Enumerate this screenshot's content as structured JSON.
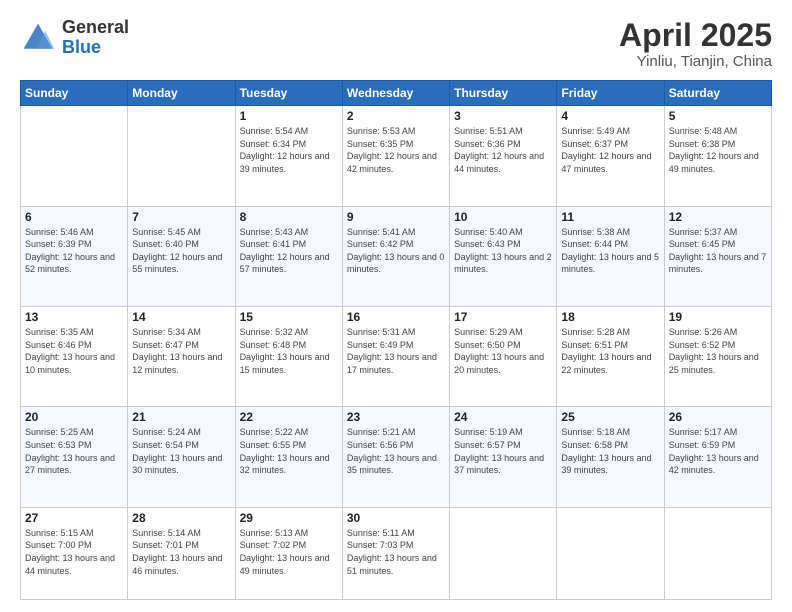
{
  "header": {
    "logo_general": "General",
    "logo_blue": "Blue",
    "title": "April 2025",
    "subtitle": "Yinliu, Tianjin, China"
  },
  "weekdays": [
    "Sunday",
    "Monday",
    "Tuesday",
    "Wednesday",
    "Thursday",
    "Friday",
    "Saturday"
  ],
  "weeks": [
    [
      {
        "day": "",
        "info": ""
      },
      {
        "day": "",
        "info": ""
      },
      {
        "day": "1",
        "info": "Sunrise: 5:54 AM\nSunset: 6:34 PM\nDaylight: 12 hours and 39 minutes."
      },
      {
        "day": "2",
        "info": "Sunrise: 5:53 AM\nSunset: 6:35 PM\nDaylight: 12 hours and 42 minutes."
      },
      {
        "day": "3",
        "info": "Sunrise: 5:51 AM\nSunset: 6:36 PM\nDaylight: 12 hours and 44 minutes."
      },
      {
        "day": "4",
        "info": "Sunrise: 5:49 AM\nSunset: 6:37 PM\nDaylight: 12 hours and 47 minutes."
      },
      {
        "day": "5",
        "info": "Sunrise: 5:48 AM\nSunset: 6:38 PM\nDaylight: 12 hours and 49 minutes."
      }
    ],
    [
      {
        "day": "6",
        "info": "Sunrise: 5:46 AM\nSunset: 6:39 PM\nDaylight: 12 hours and 52 minutes."
      },
      {
        "day": "7",
        "info": "Sunrise: 5:45 AM\nSunset: 6:40 PM\nDaylight: 12 hours and 55 minutes."
      },
      {
        "day": "8",
        "info": "Sunrise: 5:43 AM\nSunset: 6:41 PM\nDaylight: 12 hours and 57 minutes."
      },
      {
        "day": "9",
        "info": "Sunrise: 5:41 AM\nSunset: 6:42 PM\nDaylight: 13 hours and 0 minutes."
      },
      {
        "day": "10",
        "info": "Sunrise: 5:40 AM\nSunset: 6:43 PM\nDaylight: 13 hours and 2 minutes."
      },
      {
        "day": "11",
        "info": "Sunrise: 5:38 AM\nSunset: 6:44 PM\nDaylight: 13 hours and 5 minutes."
      },
      {
        "day": "12",
        "info": "Sunrise: 5:37 AM\nSunset: 6:45 PM\nDaylight: 13 hours and 7 minutes."
      }
    ],
    [
      {
        "day": "13",
        "info": "Sunrise: 5:35 AM\nSunset: 6:46 PM\nDaylight: 13 hours and 10 minutes."
      },
      {
        "day": "14",
        "info": "Sunrise: 5:34 AM\nSunset: 6:47 PM\nDaylight: 13 hours and 12 minutes."
      },
      {
        "day": "15",
        "info": "Sunrise: 5:32 AM\nSunset: 6:48 PM\nDaylight: 13 hours and 15 minutes."
      },
      {
        "day": "16",
        "info": "Sunrise: 5:31 AM\nSunset: 6:49 PM\nDaylight: 13 hours and 17 minutes."
      },
      {
        "day": "17",
        "info": "Sunrise: 5:29 AM\nSunset: 6:50 PM\nDaylight: 13 hours and 20 minutes."
      },
      {
        "day": "18",
        "info": "Sunrise: 5:28 AM\nSunset: 6:51 PM\nDaylight: 13 hours and 22 minutes."
      },
      {
        "day": "19",
        "info": "Sunrise: 5:26 AM\nSunset: 6:52 PM\nDaylight: 13 hours and 25 minutes."
      }
    ],
    [
      {
        "day": "20",
        "info": "Sunrise: 5:25 AM\nSunset: 6:53 PM\nDaylight: 13 hours and 27 minutes."
      },
      {
        "day": "21",
        "info": "Sunrise: 5:24 AM\nSunset: 6:54 PM\nDaylight: 13 hours and 30 minutes."
      },
      {
        "day": "22",
        "info": "Sunrise: 5:22 AM\nSunset: 6:55 PM\nDaylight: 13 hours and 32 minutes."
      },
      {
        "day": "23",
        "info": "Sunrise: 5:21 AM\nSunset: 6:56 PM\nDaylight: 13 hours and 35 minutes."
      },
      {
        "day": "24",
        "info": "Sunrise: 5:19 AM\nSunset: 6:57 PM\nDaylight: 13 hours and 37 minutes."
      },
      {
        "day": "25",
        "info": "Sunrise: 5:18 AM\nSunset: 6:58 PM\nDaylight: 13 hours and 39 minutes."
      },
      {
        "day": "26",
        "info": "Sunrise: 5:17 AM\nSunset: 6:59 PM\nDaylight: 13 hours and 42 minutes."
      }
    ],
    [
      {
        "day": "27",
        "info": "Sunrise: 5:15 AM\nSunset: 7:00 PM\nDaylight: 13 hours and 44 minutes."
      },
      {
        "day": "28",
        "info": "Sunrise: 5:14 AM\nSunset: 7:01 PM\nDaylight: 13 hours and 46 minutes."
      },
      {
        "day": "29",
        "info": "Sunrise: 5:13 AM\nSunset: 7:02 PM\nDaylight: 13 hours and 49 minutes."
      },
      {
        "day": "30",
        "info": "Sunrise: 5:11 AM\nSunset: 7:03 PM\nDaylight: 13 hours and 51 minutes."
      },
      {
        "day": "",
        "info": ""
      },
      {
        "day": "",
        "info": ""
      },
      {
        "day": "",
        "info": ""
      }
    ]
  ]
}
